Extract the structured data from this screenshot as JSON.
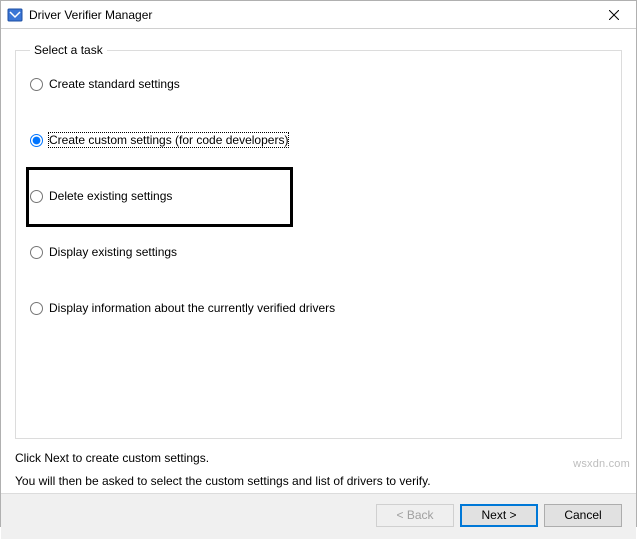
{
  "window": {
    "title": "Driver Verifier Manager",
    "close_tooltip": "Close"
  },
  "group": {
    "legend": "Select a task"
  },
  "options": [
    {
      "label": "Create standard settings",
      "checked": false
    },
    {
      "label": "Create custom settings (for code developers)",
      "checked": true
    },
    {
      "label": "Delete existing settings",
      "checked": false
    },
    {
      "label": "Display existing settings",
      "checked": false
    },
    {
      "label": "Display information about the currently verified drivers",
      "checked": false
    }
  ],
  "instructions": {
    "line1": "Click Next to create custom settings.",
    "line2": "You will then be asked to select the custom settings and list of drivers to verify."
  },
  "buttons": {
    "back": "< Back",
    "next": "Next >",
    "cancel": "Cancel"
  },
  "watermark": "wsxdn.com"
}
